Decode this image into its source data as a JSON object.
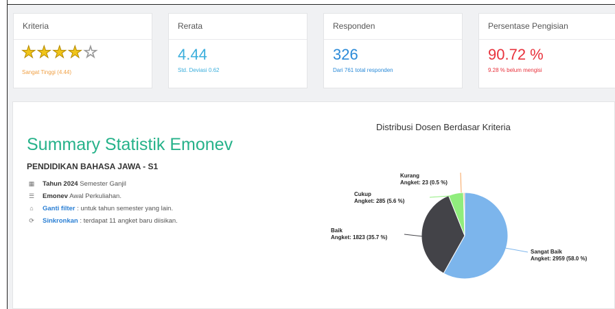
{
  "cards": {
    "kriteria": {
      "header": "Kriteria",
      "rating_text": "Sangat Tinggi (4.44)",
      "stars_filled": 4,
      "stars_total": 5
    },
    "rerata": {
      "header": "Rerata",
      "value": "4.44",
      "sub": "Std. Deviasi 0.62",
      "color": "#3aaedc"
    },
    "responden": {
      "header": "Responden",
      "value": "326",
      "sub": "Dari 761 total responden",
      "color": "#2a8ad8"
    },
    "persentase": {
      "header": "Persentase Pengisian",
      "value": "90.72 %",
      "sub": "9.28 % belum mengisi",
      "color": "#e8323c"
    }
  },
  "summary": {
    "title": "Summary Statistik Emonev",
    "subtitle": "PENDIDIKAN BAHASA JAWA - S1",
    "items": [
      {
        "icon": "calendar-icon",
        "bold": "Tahun 2024",
        "text": " Semester Ganjil"
      },
      {
        "icon": "list-icon",
        "bold": "Emonev",
        "text": " Awal Perkuliahan."
      },
      {
        "icon": "filter-icon",
        "link": "Ganti filter",
        "text": " : untuk tahun semester yang lain."
      },
      {
        "icon": "sync-icon",
        "link": "Sinkronkan",
        "text": " : terdapat 11 angket baru diisikan."
      }
    ]
  },
  "chart_data": {
    "type": "pie",
    "title": "Distribusi Dosen Berdasar Kriteria",
    "slices": [
      {
        "name": "Sangat Baik",
        "value": 2959,
        "percent": 58.0,
        "color": "#7cb5ec",
        "label": "Angket: 2959 (58.0 %)"
      },
      {
        "name": "Baik",
        "value": 1823,
        "percent": 35.7,
        "color": "#434348",
        "label": "Angket: 1823 (35.7 %)"
      },
      {
        "name": "Cukup",
        "value": 285,
        "percent": 5.6,
        "color": "#90ed7d",
        "label": "Angket: 285 (5.6 %)"
      },
      {
        "name": "Kurang",
        "value": 23,
        "percent": 0.5,
        "color": "#f7a35c",
        "label": "Angket: 23 (0.5 %)"
      }
    ]
  }
}
